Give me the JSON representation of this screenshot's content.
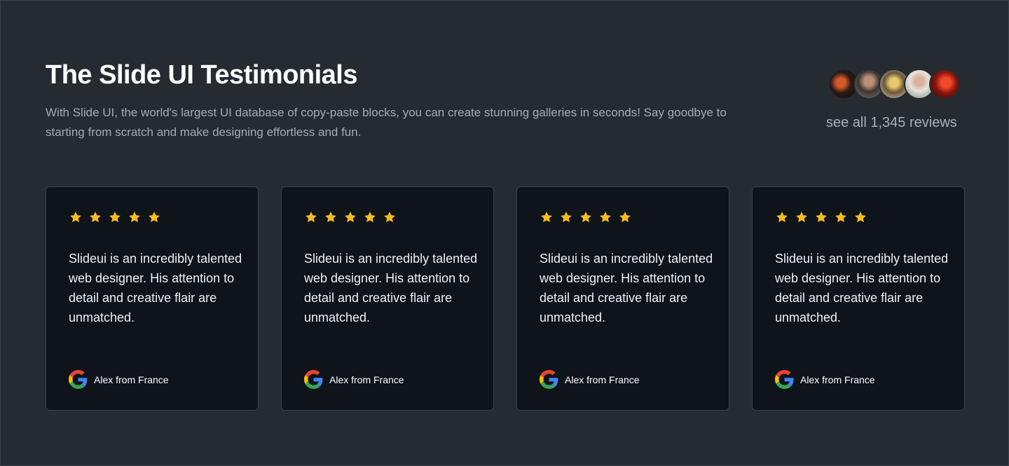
{
  "header": {
    "title": "The Slide UI Testimonials",
    "subtitle": "With Slide UI, the world's largest UI database of copy-paste blocks, you can create stunning galleries in seconds! Say goodbye to starting from scratch and make designing effortless and fun."
  },
  "reviews_summary": {
    "link_label": "see all 1,345 reviews",
    "avatars": [
      "avatar-1",
      "avatar-2",
      "avatar-3",
      "avatar-4",
      "avatar-5"
    ]
  },
  "testimonials": [
    {
      "rating": 5,
      "quote": "Slideui is an incredibly talented web designer. His attention to detail and creative flair are unmatched.",
      "author": "Alex from France",
      "source_icon": "google-icon"
    },
    {
      "rating": 5,
      "quote": "Slideui is an incredibly talented web designer. His attention to detail and creative flair are unmatched.",
      "author": "Alex from France",
      "source_icon": "google-icon"
    },
    {
      "rating": 5,
      "quote": "Slideui is an incredibly talented web designer. His attention to detail and creative flair are unmatched.",
      "author": "Alex from France",
      "source_icon": "google-icon"
    },
    {
      "rating": 5,
      "quote": "Slideui is an incredibly talented web designer. His attention to detail and creative flair are unmatched.",
      "author": "Alex from France",
      "source_icon": "google-icon"
    }
  ],
  "colors": {
    "background": "#262b32",
    "card_background": "#0f131a",
    "star": "#f7bd1f",
    "title": "#ffffff",
    "muted_text": "#a4abb5"
  }
}
